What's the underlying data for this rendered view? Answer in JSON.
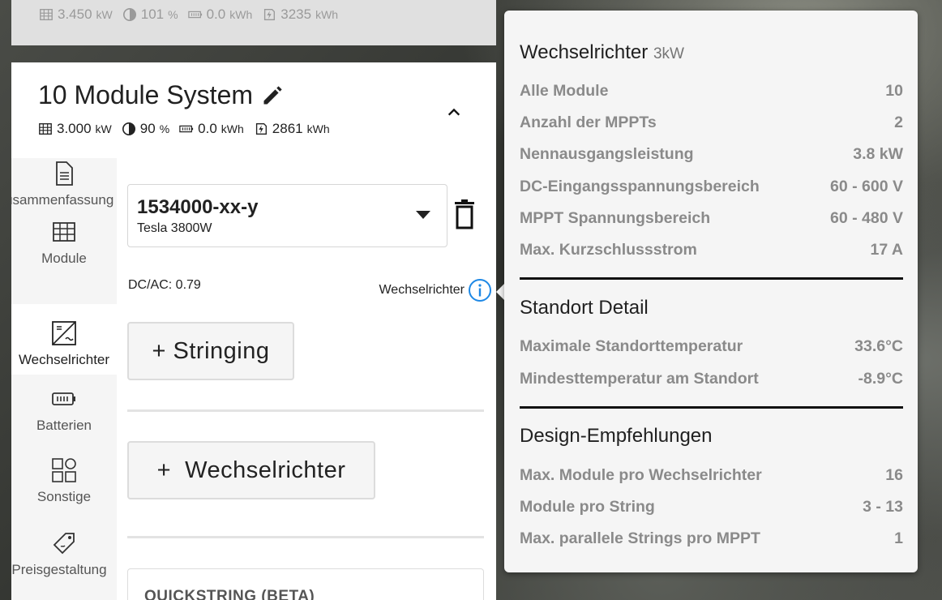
{
  "previous_system": {
    "stats": {
      "power_value": "3.450",
      "power_unit": "kW",
      "ratio_value": "101",
      "ratio_unit": "%",
      "battery_value": "0.0",
      "battery_unit": "kWh",
      "energy_value": "3235",
      "energy_unit": "kWh"
    }
  },
  "system": {
    "title": "10 Module System",
    "stats": {
      "power_value": "3.000",
      "power_unit": "kW",
      "ratio_value": "90",
      "ratio_unit": "%",
      "battery_value": "0.0",
      "battery_unit": "kWh",
      "energy_value": "2861",
      "energy_unit": "kWh"
    }
  },
  "sidebar": {
    "items": [
      {
        "label": "Zusammenfassung",
        "icon": "document-icon"
      },
      {
        "label": "Module",
        "icon": "grid-icon"
      },
      {
        "label": "Wechselrichter",
        "icon": "inverter-icon",
        "active": true
      },
      {
        "label": "Batterien",
        "icon": "battery-icon"
      },
      {
        "label": "Sonstige",
        "icon": "apps-icon"
      },
      {
        "label": "Preisgestaltung",
        "icon": "price-tag-icon"
      }
    ]
  },
  "inverter": {
    "sku": "1534000-xx-y",
    "model": "Tesla 3800W",
    "dc_ac": "DC/AC: 0.79",
    "info_link": "Wechselrichter",
    "stringing_button": "+ Stringing",
    "add_inverter_button": "+  Wechselrichter",
    "quickstring_title": "QUICKSTRING (BETA)"
  },
  "popover": {
    "title": "Wechselrichter",
    "title_suffix": "3kW",
    "specs": [
      {
        "label": "Alle Module",
        "value": "10"
      },
      {
        "label": "Anzahl der MPPTs",
        "value": "2"
      },
      {
        "label": "Nennausgangsleistung",
        "value": "3.8 kW"
      },
      {
        "label": "DC-Eingangsspannungsbereich",
        "value": "60 - 600 V"
      },
      {
        "label": "MPPT Spannungsbereich",
        "value": "60 - 480 V"
      },
      {
        "label": "Max. Kurzschlussstrom",
        "value": "17 A"
      }
    ],
    "site_title": "Standort Detail",
    "site": [
      {
        "label": "Maximale Standorttemperatur",
        "value": "33.6°C"
      },
      {
        "label": "Mindesttemperatur am Standort",
        "value": "-8.9°C"
      }
    ],
    "design_title": "Design-Empfehlungen",
    "design": [
      {
        "label": "Max. Module pro Wechselrichter",
        "value": "16"
      },
      {
        "label": "Module pro String",
        "value": "3 - 13"
      },
      {
        "label": "Max. parallele Strings pro MPPT",
        "value": "1"
      }
    ]
  },
  "colors": {
    "accent": "#1e88e5",
    "text": "#212121",
    "muted": "#8a8a8a"
  }
}
